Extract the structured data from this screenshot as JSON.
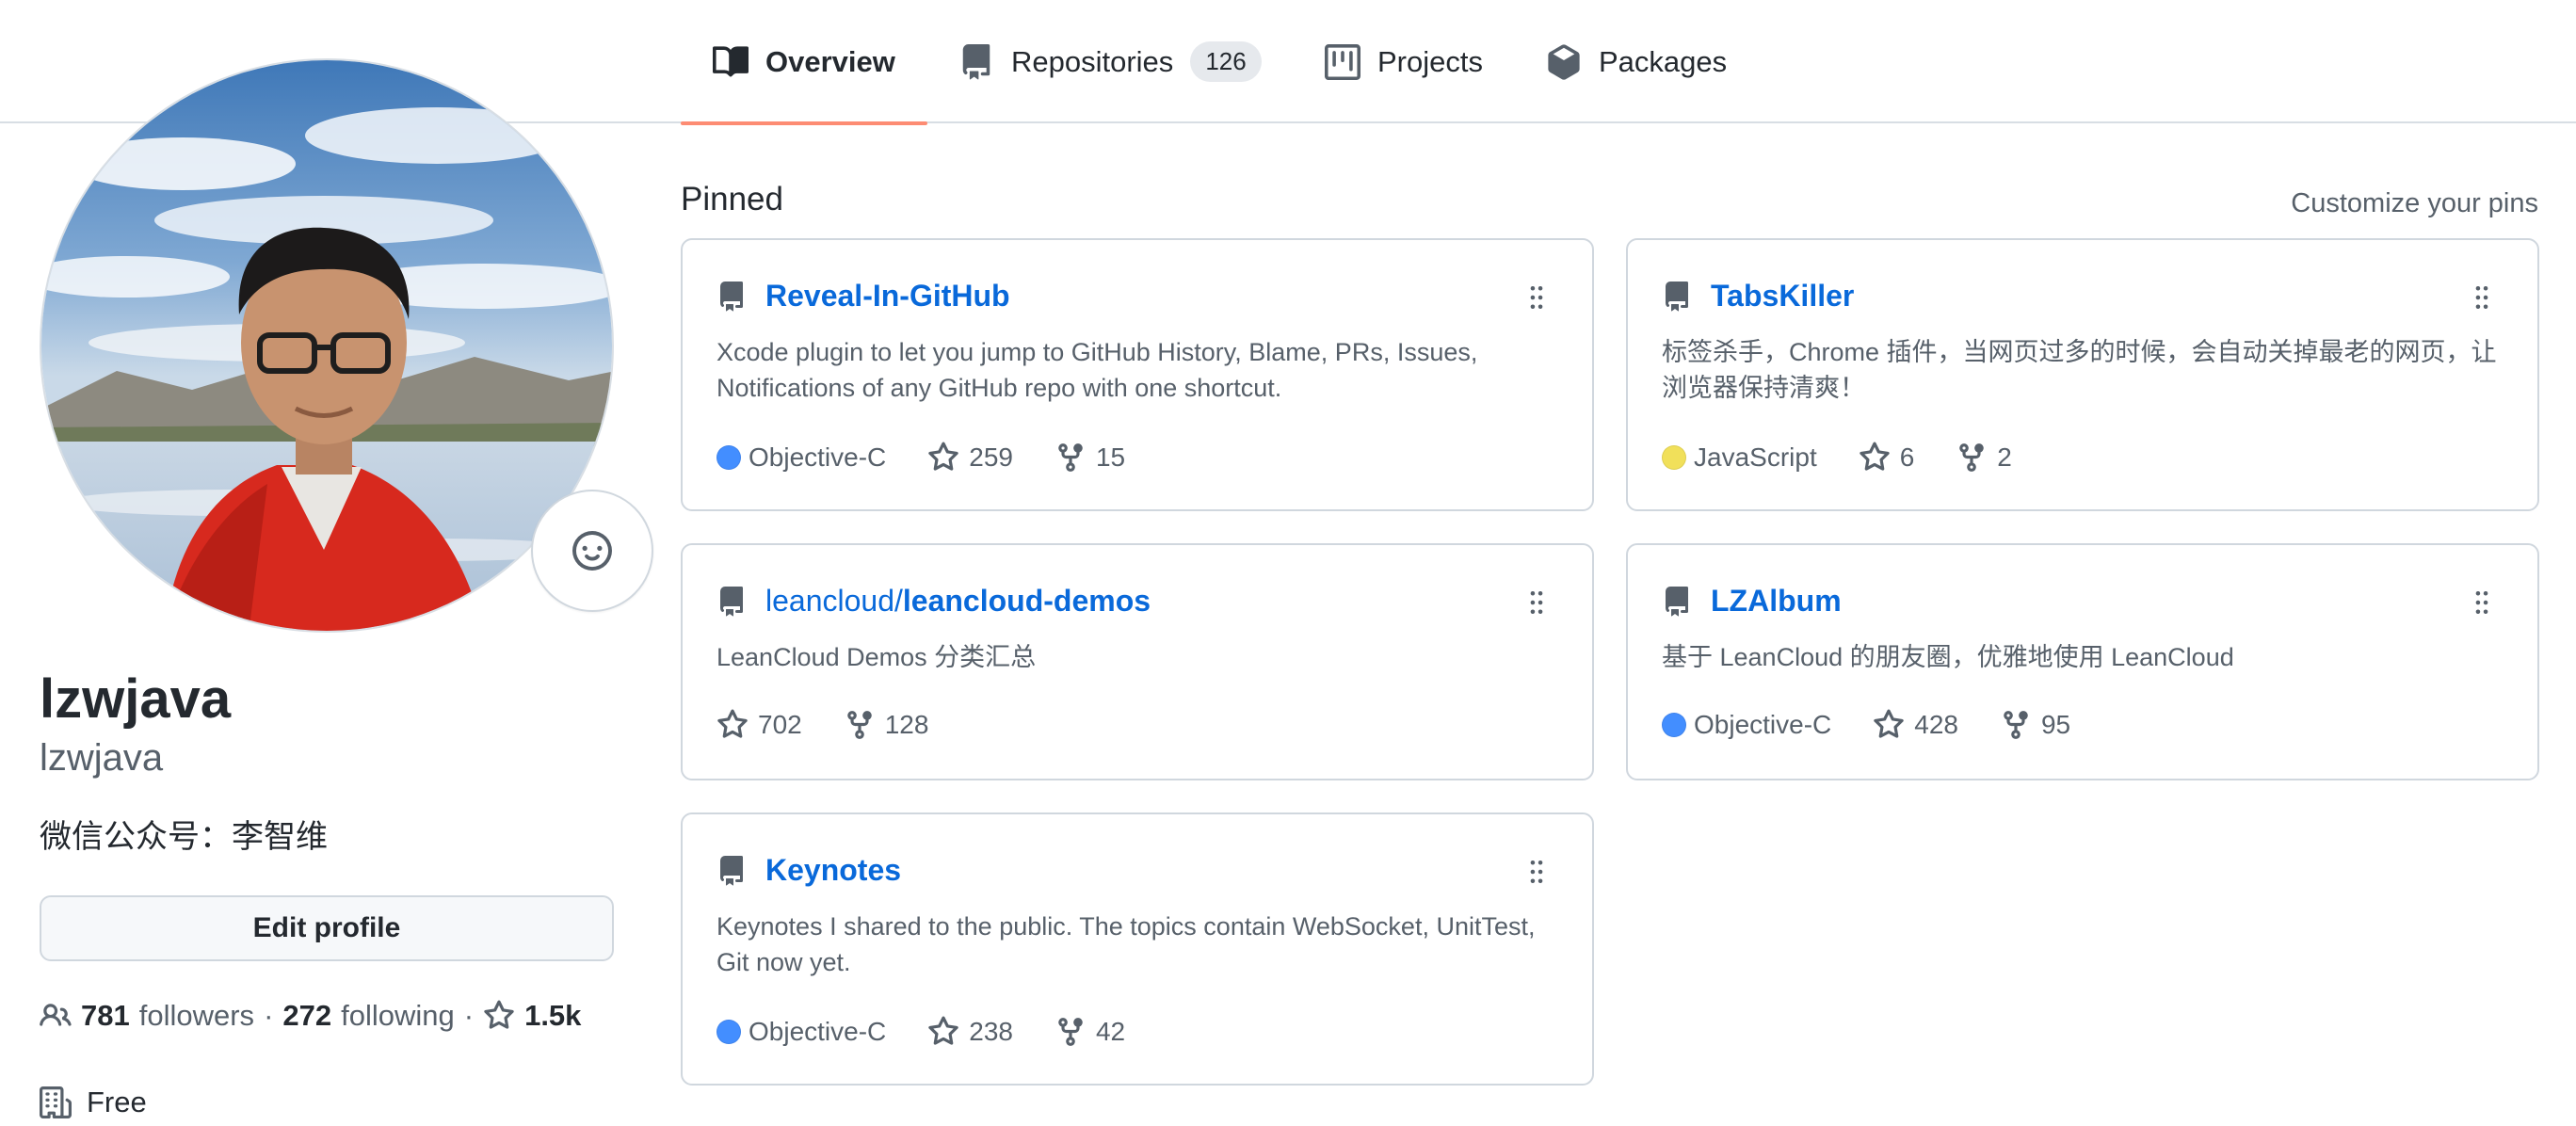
{
  "tabs": [
    {
      "label": "Overview",
      "icon": "book-icon",
      "active": true
    },
    {
      "label": "Repositories",
      "icon": "repo-icon",
      "count": "126"
    },
    {
      "label": "Projects",
      "icon": "project-icon"
    },
    {
      "label": "Packages",
      "icon": "package-icon"
    }
  ],
  "profile": {
    "fullname": "lzwjava",
    "login": "lzwjava",
    "bio": "微信公众号：李智维",
    "edit_label": "Edit profile",
    "followers_count": "781",
    "followers_label": "followers",
    "following_count": "272",
    "following_label": "following",
    "stars_count": "1.5k",
    "separator": "·",
    "plan": "Free"
  },
  "pinned": {
    "title": "Pinned",
    "customize_label": "Customize your pins",
    "repos": [
      {
        "owner": "",
        "name": "Reveal-In-GitHub",
        "description": "Xcode plugin to let you jump to GitHub History, Blame, PRs, Issues, Notifications of any GitHub repo with one shortcut.",
        "language": "Objective-C",
        "language_color": "#438eff",
        "stars": "259",
        "forks": "15"
      },
      {
        "owner": "",
        "name": "TabsKiller",
        "description": "标签杀手，Chrome 插件，当网页过多的时候，会自动关掉最老的网页，让浏览器保持清爽！",
        "language": "JavaScript",
        "language_color": "#f1e05a",
        "stars": "6",
        "forks": "2"
      },
      {
        "owner": "leancloud/",
        "name": "leancloud-demos",
        "description": "LeanCloud Demos 分类汇总",
        "language": "",
        "language_color": "",
        "stars": "702",
        "forks": "128"
      },
      {
        "owner": "",
        "name": "LZAlbum",
        "description": "基于 LeanCloud 的朋友圈，优雅地使用 LeanCloud",
        "language": "Objective-C",
        "language_color": "#438eff",
        "stars": "428",
        "forks": "95"
      },
      {
        "owner": "",
        "name": "Keynotes",
        "description": "Keynotes I shared to the public. The topics contain WebSocket, UnitTest, Git now yet.",
        "language": "Objective-C",
        "language_color": "#438eff",
        "stars": "238",
        "forks": "42"
      }
    ]
  },
  "colors": {
    "accent": "#0969da",
    "tab_underline": "#fd8c73",
    "objective_c": "#438eff",
    "javascript": "#f1e05a"
  }
}
